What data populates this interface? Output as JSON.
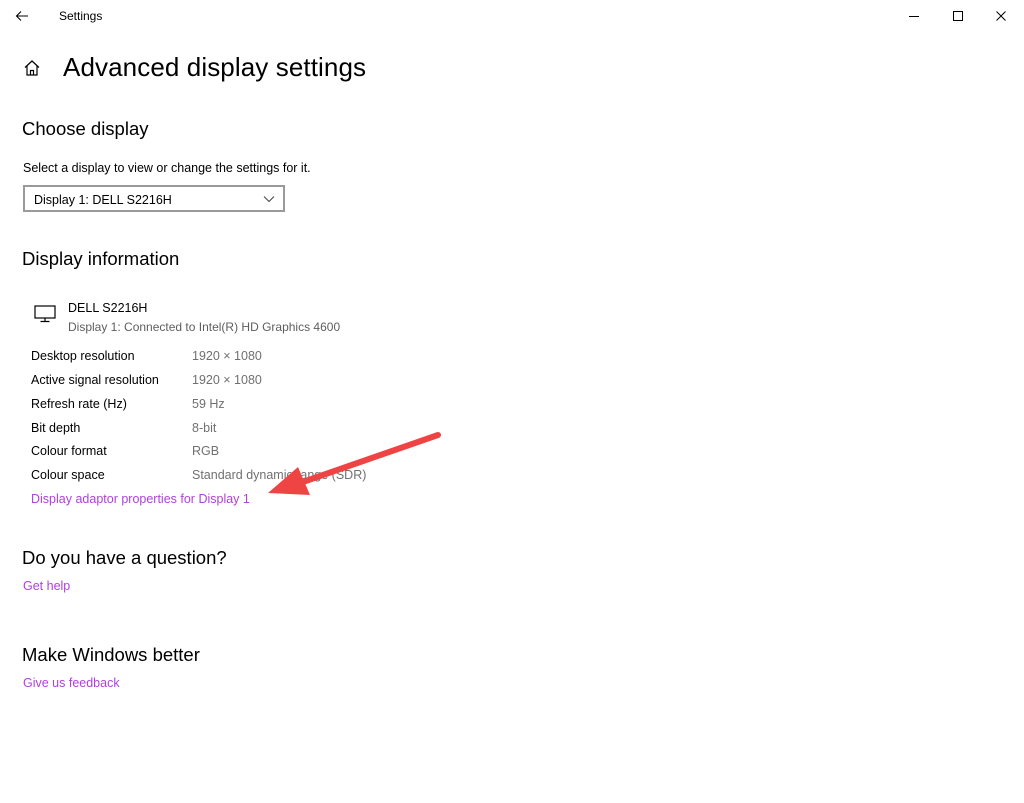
{
  "window": {
    "title": "Settings"
  },
  "page": {
    "title": "Advanced display settings"
  },
  "choose_display": {
    "heading": "Choose display",
    "description": "Select a display to view or change the settings for it.",
    "selected_display": "Display 1: DELL S2216H"
  },
  "display_info": {
    "heading": "Display information",
    "monitor_name": "DELL S2216H",
    "monitor_connection": "Display 1: Connected to Intel(R) HD Graphics 4600",
    "rows": [
      {
        "label": "Desktop resolution",
        "value": "1920 × 1080"
      },
      {
        "label": "Active signal resolution",
        "value": "1920 × 1080"
      },
      {
        "label": "Refresh rate (Hz)",
        "value": "59 Hz"
      },
      {
        "label": "Bit depth",
        "value": "8-bit"
      },
      {
        "label": "Colour format",
        "value": "RGB"
      },
      {
        "label": "Colour space",
        "value": "Standard dynamic range (SDR)"
      }
    ],
    "adapter_link": "Display adaptor properties for Display 1"
  },
  "help": {
    "heading": "Do you have a question?",
    "link": "Get help"
  },
  "feedback": {
    "heading": "Make Windows better",
    "link": "Give us feedback"
  },
  "colors": {
    "link": "#b040e0",
    "annotation_arrow": "#ef4444",
    "secondary_text": "#707070"
  },
  "icons": {
    "back": "arrow-left-icon",
    "minimize": "minimize-icon",
    "maximize": "maximize-icon",
    "close": "close-icon",
    "home": "home-icon",
    "dropdown": "chevron-down-icon",
    "monitor": "monitor-icon"
  }
}
